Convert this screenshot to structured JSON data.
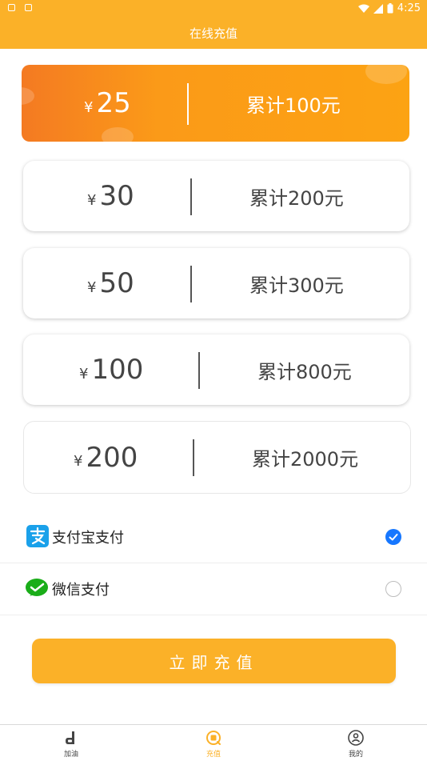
{
  "status_bar": {
    "time": "4:25"
  },
  "header": {
    "title": "在线充值"
  },
  "currency_symbol": "¥",
  "options": [
    {
      "amount": "25",
      "cumulative": "累计100元",
      "selected": true
    },
    {
      "amount": "30",
      "cumulative": "累计200元",
      "selected": false
    },
    {
      "amount": "50",
      "cumulative": "累计300元",
      "selected": false
    },
    {
      "amount": "100",
      "cumulative": "累计800元",
      "selected": false
    },
    {
      "amount": "200",
      "cumulative": "累计2000元",
      "selected": false
    }
  ],
  "payment_methods": [
    {
      "label": "支付宝支付",
      "icon": "alipay-icon",
      "checked": true
    },
    {
      "label": "微信支付",
      "icon": "wechat-icon",
      "checked": false
    }
  ],
  "recharge_button": "立即充值",
  "tabs": [
    {
      "label": "加油",
      "icon": "fuel-icon",
      "active": false
    },
    {
      "label": "充值",
      "icon": "recharge-icon",
      "active": true
    },
    {
      "label": "我的",
      "icon": "profile-icon",
      "active": false
    }
  ],
  "colors": {
    "accent": "#fbb128",
    "selected_gradient_start": "#f47a22",
    "selected_gradient_end": "#fca313",
    "check_blue": "#1677ff"
  }
}
